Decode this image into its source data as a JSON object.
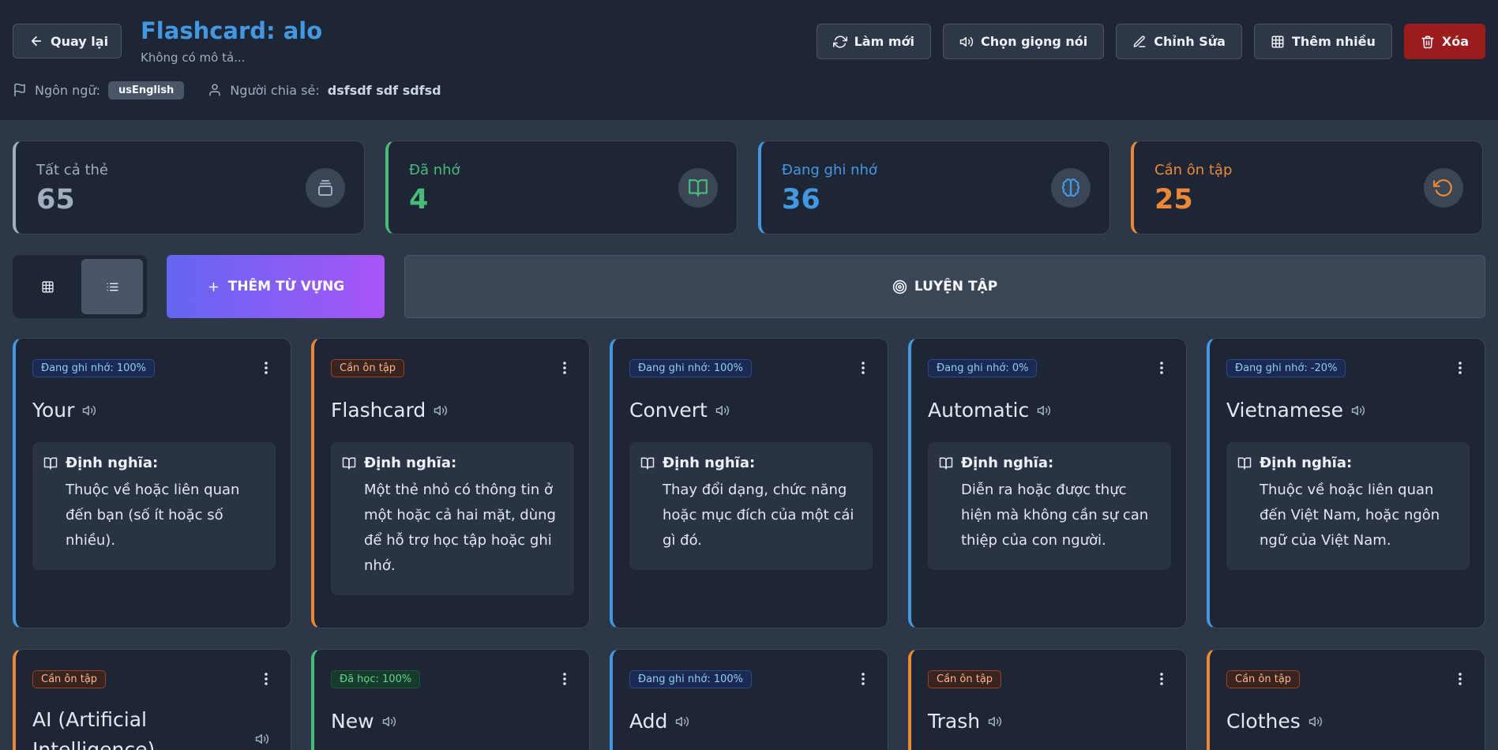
{
  "header": {
    "back_label": "Quay lại",
    "title": "Flashcard: alo",
    "subtitle": "Không có mô tả...",
    "language_label": "Ngôn ngữ:",
    "language_value": "usEnglish",
    "sharer_label": "Người chia sẻ:",
    "sharer_value": "dsfsdf sdf sdfsd"
  },
  "actions": {
    "refresh": "Làm mới",
    "voice": "Chọn giọng nói",
    "edit": "Chỉnh Sửa",
    "add_many": "Thêm nhiều",
    "delete": "Xóa"
  },
  "stats": [
    {
      "label": "Tất cả thẻ",
      "value": "65",
      "color": "#a0aec0",
      "icon": "cards-stack-icon"
    },
    {
      "label": "Đã nhớ",
      "value": "4",
      "color": "#48bb78",
      "icon": "book-open-icon"
    },
    {
      "label": "Đang ghi nhớ",
      "value": "36",
      "color": "#4299e1",
      "icon": "brain-icon"
    },
    {
      "label": "Cần ôn tập",
      "value": "25",
      "color": "#ed8936",
      "icon": "rotate-ccw-icon"
    }
  ],
  "toolbar": {
    "add_word": "THÊM TỪ VỰNG",
    "practice": "LUYỆN TẬP"
  },
  "cards": [
    {
      "badge": "Đang ghi nhớ: 100%",
      "word": "Your",
      "def_label": "Định nghĩa:",
      "definition": "Thuộc về hoặc liên quan đến bạn (số ít hoặc số nhiều).",
      "accent": "#4299e1"
    },
    {
      "badge": "Cần ôn tập",
      "word": "Flashcard",
      "def_label": "Định nghĩa:",
      "definition": "Một thẻ nhỏ có thông tin ở một hoặc cả hai mặt, dùng để hỗ trợ học tập hoặc ghi nhớ.",
      "accent": "#ed8936"
    },
    {
      "badge": "Đang ghi nhớ: 100%",
      "word": "Convert",
      "def_label": "Định nghĩa:",
      "definition": "Thay đổi dạng, chức năng hoặc mục đích của một cái gì đó.",
      "accent": "#4299e1"
    },
    {
      "badge": "Đang ghi nhớ: 0%",
      "word": "Automatic",
      "def_label": "Định nghĩa:",
      "definition": "Diễn ra hoặc được thực hiện mà không cần sự can thiệp của con người.",
      "accent": "#4299e1"
    },
    {
      "badge": "Đang ghi nhớ: -20%",
      "word": "Vietnamese",
      "def_label": "Định nghĩa:",
      "definition": "Thuộc về hoặc liên quan đến Việt Nam, hoặc ngôn ngữ của Việt Nam.",
      "accent": "#4299e1"
    },
    {
      "badge": "Cần ôn tập",
      "word": "AI (Artificial Intelligence)",
      "accent": "#ed8936"
    },
    {
      "badge": "Đã học: 100%",
      "word": "New",
      "accent": "#48bb78"
    },
    {
      "badge": "Đang ghi nhớ: 100%",
      "word": "Add",
      "accent": "#4299e1"
    },
    {
      "badge": "Cần ôn tập",
      "word": "Trash",
      "accent": "#ed8936"
    },
    {
      "badge": "Cần ôn tập",
      "word": "Clothes",
      "accent": "#ed8936"
    }
  ]
}
